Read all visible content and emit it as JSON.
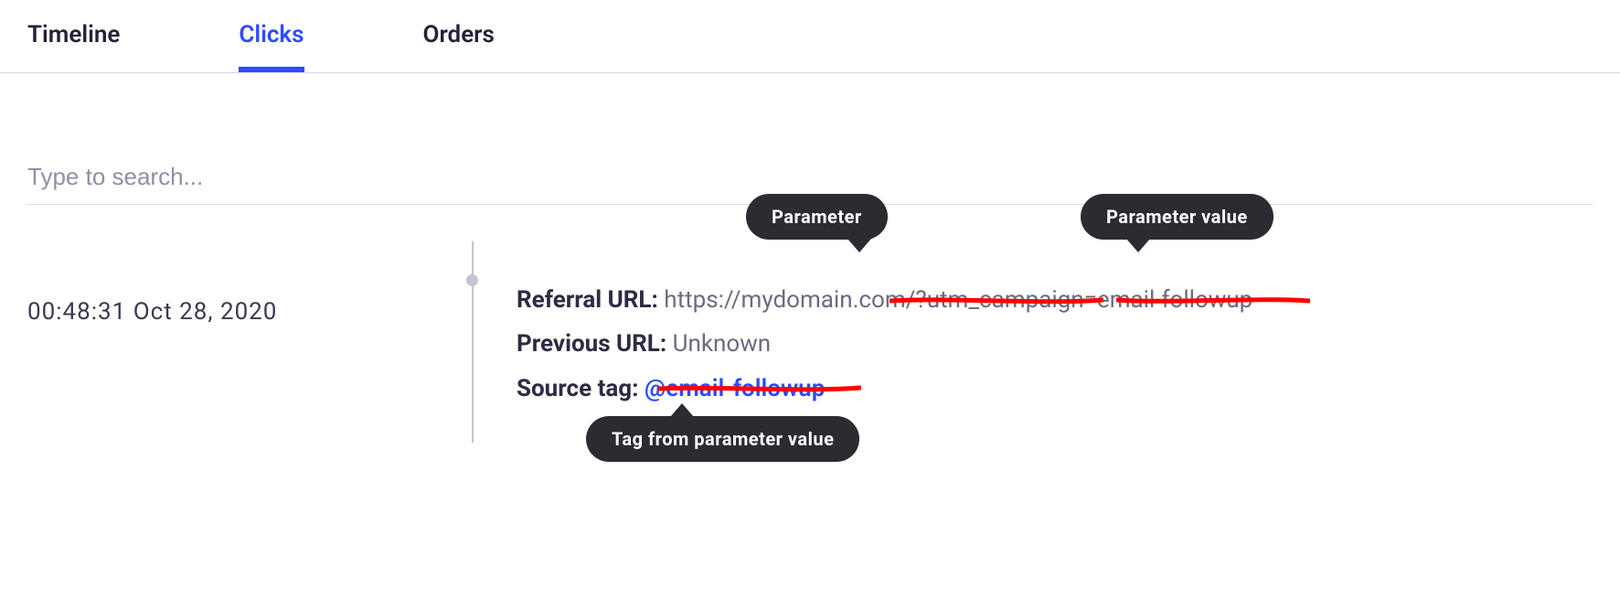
{
  "tabs": [
    {
      "label": "Timeline",
      "active": false
    },
    {
      "label": "Clicks",
      "active": true
    },
    {
      "label": "Orders",
      "active": false
    }
  ],
  "search": {
    "placeholder": "Type to search...",
    "value": ""
  },
  "entry": {
    "timestamp": "00:48:31 Oct 28, 2020",
    "referral_label": "Referral URL:",
    "referral_value": "https://mydomain.com/?utm_campaign=email-followup",
    "previous_label": "Previous URL:",
    "previous_value": "Unknown",
    "source_tag_label": "Source tag:",
    "source_tag_value": "@email-followup"
  },
  "callouts": {
    "parameter": "Parameter",
    "parameter_value": "Parameter value",
    "tag_from_value": "Tag from parameter value"
  },
  "colors": {
    "accent": "#2b4cff",
    "callout_bg": "#2b2b32",
    "underline": "#ff0000"
  }
}
